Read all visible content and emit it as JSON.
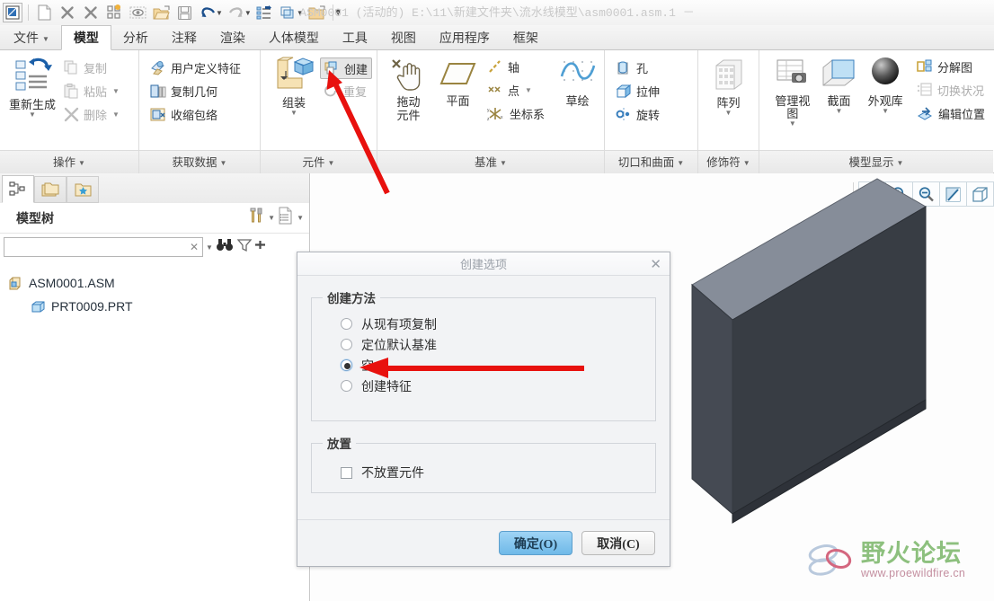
{
  "window": {
    "title": "ASM0001 (活动的) E:\\11\\新建文件夹\\流水线模型\\asm0001.asm.1  －"
  },
  "quick_access": [
    {
      "name": "app-menu-icon",
      "glyph": "▣"
    },
    {
      "name": "new-file-icon",
      "glyph": "📄"
    },
    {
      "name": "close-icon",
      "glyph": "✕"
    },
    {
      "name": "close-all-icon",
      "glyph": "✕"
    },
    {
      "name": "window-layout-icon",
      "glyph": "▤"
    },
    {
      "name": "preview-icon",
      "glyph": "◉"
    },
    {
      "name": "open-folder-icon",
      "glyph": "📂"
    },
    {
      "name": "save-icon",
      "glyph": "💾"
    },
    {
      "name": "undo-icon",
      "glyph": "↶"
    },
    {
      "name": "redo-icon",
      "glyph": "↷"
    },
    {
      "name": "regenerate-icon",
      "glyph": "≣"
    },
    {
      "name": "window-switch-icon",
      "glyph": "❐"
    },
    {
      "name": "folder-icon",
      "glyph": "📁"
    },
    {
      "name": "customize-caret-icon",
      "glyph": "▼"
    }
  ],
  "tabs": [
    {
      "label": "文件",
      "caret": true,
      "active": false
    },
    {
      "label": "模型",
      "caret": false,
      "active": true
    },
    {
      "label": "分析",
      "caret": false,
      "active": false
    },
    {
      "label": "注释",
      "caret": false,
      "active": false
    },
    {
      "label": "渲染",
      "caret": false,
      "active": false
    },
    {
      "label": "人体模型",
      "caret": false,
      "active": false
    },
    {
      "label": "工具",
      "caret": false,
      "active": false
    },
    {
      "label": "视图",
      "caret": false,
      "active": false
    },
    {
      "label": "应用程序",
      "caret": false,
      "active": false
    },
    {
      "label": "框架",
      "caret": false,
      "active": false
    }
  ],
  "ribbon": {
    "groups": [
      {
        "label": "操作",
        "big": [
          {
            "label": "重新生成",
            "caret": true
          }
        ],
        "small": [
          {
            "label": "复制",
            "dim": true,
            "caret": false
          },
          {
            "label": "粘贴",
            "dim": true,
            "caret": true
          },
          {
            "label": "删除",
            "dim": true,
            "caret": true
          }
        ]
      },
      {
        "label": "获取数据",
        "big": [],
        "small": [
          {
            "label": "用户定义特征",
            "dim": false,
            "caret": false
          },
          {
            "label": "复制几何",
            "dim": false,
            "caret": false
          },
          {
            "label": "收缩包络",
            "dim": false,
            "caret": false
          }
        ]
      },
      {
        "label": "元件",
        "big": [
          {
            "label": "组装",
            "caret": true
          }
        ],
        "small": [
          {
            "label": "创建",
            "dim": false,
            "caret": false,
            "selected": true
          },
          {
            "label": "重复",
            "dim": true,
            "caret": false
          }
        ]
      },
      {
        "label": "基准",
        "big": [
          {
            "label": "拖动\n元件",
            "caret": false
          },
          {
            "label": "平面",
            "caret": false
          },
          {
            "label": "草绘",
            "caret": false
          }
        ],
        "small": [
          {
            "label": "轴",
            "dim": false,
            "caret": false
          },
          {
            "label": "点",
            "dim": false,
            "caret": true
          },
          {
            "label": "坐标系",
            "dim": false,
            "caret": false
          }
        ]
      },
      {
        "label": "切口和曲面",
        "big": [],
        "small": [
          {
            "label": "孔",
            "dim": false,
            "caret": false
          },
          {
            "label": "拉伸",
            "dim": false,
            "caret": false
          },
          {
            "label": "旋转",
            "dim": false,
            "caret": false
          }
        ]
      },
      {
        "label": "修饰符",
        "big": [
          {
            "label": "阵列",
            "caret": true
          }
        ],
        "small": []
      },
      {
        "label": "模型显示",
        "big": [
          {
            "label": "管理视图",
            "caret": true
          },
          {
            "label": "截面",
            "caret": true
          },
          {
            "label": "外观库",
            "caret": true
          }
        ],
        "small": [
          {
            "label": "分解图",
            "dim": false,
            "caret": false
          },
          {
            "label": "切换状况",
            "dim": true,
            "caret": false
          },
          {
            "label": "编辑位置",
            "dim": false,
            "caret": false
          }
        ]
      }
    ]
  },
  "left_panel": {
    "tree_tabs": [
      {
        "name": "model-tree-tab",
        "active": true
      },
      {
        "name": "folder-browser-tab",
        "active": false
      },
      {
        "name": "favorites-tab",
        "active": false
      }
    ],
    "title": "模型树",
    "search": {
      "value": "",
      "placeholder": ""
    },
    "head_icons": [
      "settings-tools-icon",
      "display-list-icon"
    ],
    "search_icons": [
      "find-binoculars-icon",
      "filter-icon",
      "expand-icon"
    ],
    "tree": [
      {
        "label": "ASM0001.ASM",
        "level": 0,
        "icon": "assembly-icon"
      },
      {
        "label": "PRT0009.PRT",
        "level": 1,
        "icon": "part-icon"
      }
    ]
  },
  "view_toolbar": [
    {
      "name": "refit-zoom-icon"
    },
    {
      "name": "zoom-in-icon"
    },
    {
      "name": "zoom-out-icon"
    },
    {
      "name": "repaint-icon"
    },
    {
      "name": "display-style-icon"
    }
  ],
  "dialog": {
    "title": "创建选项",
    "close_label": "✕",
    "groups": [
      {
        "legend": "创建方法",
        "type": "radio",
        "options": [
          {
            "label": "从现有项复制",
            "checked": false
          },
          {
            "label": "定位默认基准",
            "checked": false
          },
          {
            "label": "空",
            "checked": true
          },
          {
            "label": "创建特征",
            "checked": false
          }
        ]
      },
      {
        "legend": "放置",
        "type": "checkbox",
        "options": [
          {
            "label": "不放置元件",
            "checked": false
          }
        ]
      }
    ],
    "buttons": {
      "ok": "确定(O)",
      "cancel": "取消(C)"
    }
  },
  "watermark": {
    "main": "野火论坛",
    "sub": "www.proewildfire.cn"
  },
  "colors": {
    "accent": "#6fb9e8",
    "arrow": "#e8110e",
    "model_top": "#8e94a0",
    "model_front": "#3c4148",
    "model_side": "#4f555e",
    "watermark_green": "#8dc07e",
    "watermark_pink": "#c48fa0"
  }
}
